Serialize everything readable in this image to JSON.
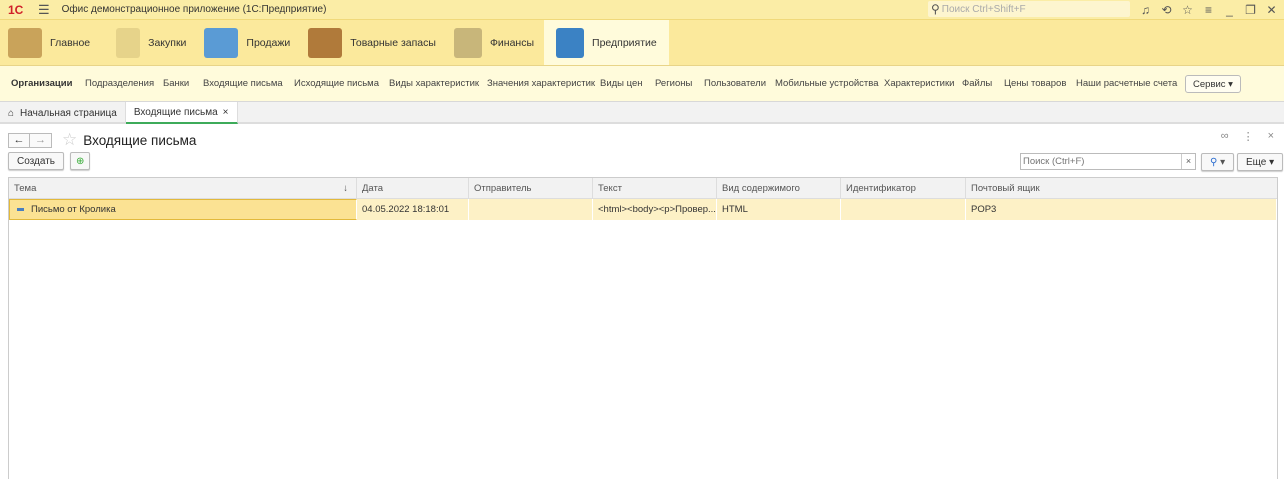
{
  "app": {
    "logo": "1С",
    "title": "Офис демонстрационное приложение  (1С:Предприятие)",
    "search_placeholder": "Поиск Ctrl+Shift+F"
  },
  "sections": [
    {
      "label": "Главное",
      "color": "#c9a35a"
    },
    {
      "label": "Закупки",
      "color": "#e6d38a"
    },
    {
      "label": "Продажи",
      "color": "#5a9bd5"
    },
    {
      "label": "Товарные запасы",
      "color": "#b07a3a"
    },
    {
      "label": "Финансы",
      "color": "#c8b67a"
    },
    {
      "label": "Предприятие",
      "color": "#3b82c4"
    }
  ],
  "subnav": {
    "items": [
      "Организации",
      "Подразделения",
      "Банки",
      "Входящие письма",
      "Исходящие письма",
      "Виды характеристик",
      "Значения характеристик",
      "Виды цен",
      "Регионы",
      "Пользователи",
      "Мобильные устройства",
      "Характеристики",
      "Файлы",
      "Цены товаров",
      "Наши расчетные счета"
    ],
    "service": "Сервис ▾"
  },
  "tabs": [
    {
      "label": "Начальная страница"
    },
    {
      "label": "Входящие письма",
      "close": "×"
    }
  ],
  "page": {
    "title": "Входящие письма",
    "create": "Создать",
    "search_placeholder": "Поиск (Ctrl+F)",
    "clear": "×",
    "search_btn": "▾",
    "more": "Еще ▾"
  },
  "table": {
    "columns": [
      "Тема",
      "Дата",
      "Отправитель",
      "Текст",
      "Вид содержимого",
      "Идентификатор",
      "Почтовый ящик"
    ],
    "sort_indicator": "↓",
    "rows": [
      [
        "Письмо от Кролика",
        "04.05.2022 18:18:01",
        "",
        "<html><body><p>Провер...",
        "HTML",
        "",
        "POP3"
      ]
    ]
  }
}
